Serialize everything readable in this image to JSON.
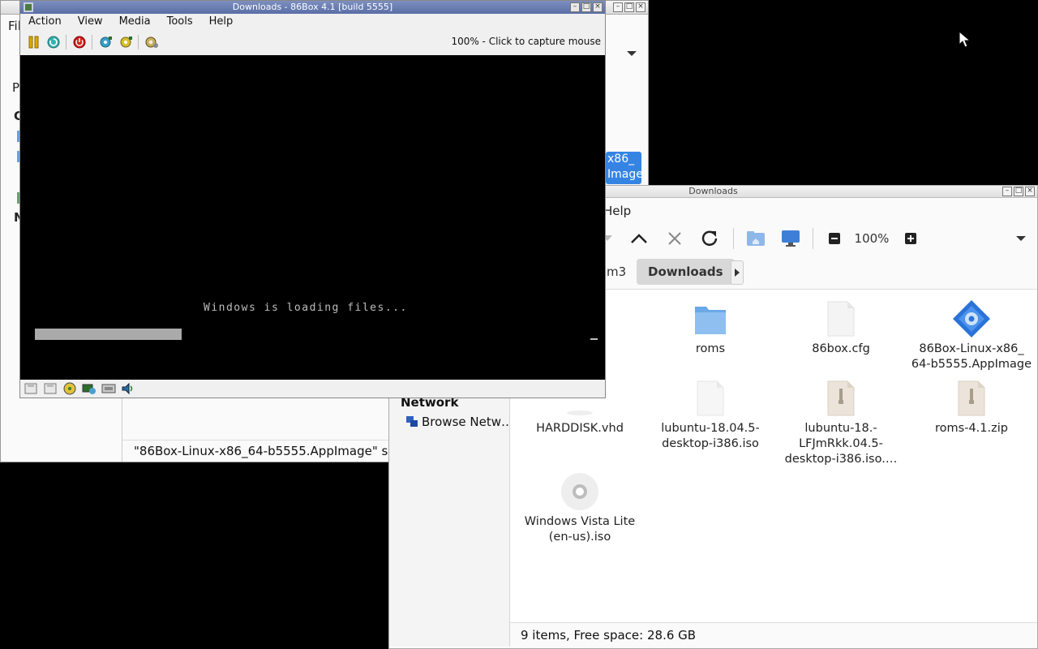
{
  "back_window": {
    "menu_file_fragment": "Fil",
    "frag_p": "P",
    "frag_c": "C",
    "frag_n": "N",
    "selected_badge": "x86_\nImage",
    "status": "\"86Box-Linux-x86_64-b5555.AppImage\" selected"
  },
  "file_manager": {
    "title": "Downloads",
    "menu_help": "Help",
    "zoom_level": "100%",
    "path_prev": "m3",
    "path_current": "Downloads",
    "sidebar_heading": "Network",
    "sidebar_item": "Browse Netw…",
    "files": [
      {
        "name": "roms",
        "icon": "folder-icon"
      },
      {
        "name": "86box.cfg",
        "icon": "document-icon"
      },
      {
        "name": "86Box-Linux-x86_\n64-b5555.AppImage",
        "icon": "appimage-icon"
      },
      {
        "name": "HARDDISK.vhd",
        "icon": "disk-image-icon"
      },
      {
        "name": "lubuntu-18.04.5-\ndesktop-i386.iso",
        "icon": "document-icon"
      },
      {
        "name": "lubuntu-18.-\nLFJmRkk.04.5-\ndesktop-i386.iso.…",
        "icon": "archive-icon"
      },
      {
        "name": "roms-4.1.zip",
        "icon": "archive-icon"
      },
      {
        "name": "Windows Vista Lite\n(en-us).iso",
        "icon": "optical-disc-icon"
      }
    ],
    "status": "9 items, Free space: 28.6 GB"
  },
  "box86": {
    "title": "Downloads - 86Box 4.1 [build 5555]",
    "menus": [
      "Action",
      "View",
      "Media",
      "Tools",
      "Help"
    ],
    "capture_hint": "100% - Click to capture mouse",
    "screen_text": "Windows is loading files...",
    "progress": 0.25
  },
  "colors": {
    "accent": "#3584e4",
    "box_title": "#5a6ea6",
    "screen_bg": "#000000",
    "screen_text": "#bdbdbd"
  }
}
